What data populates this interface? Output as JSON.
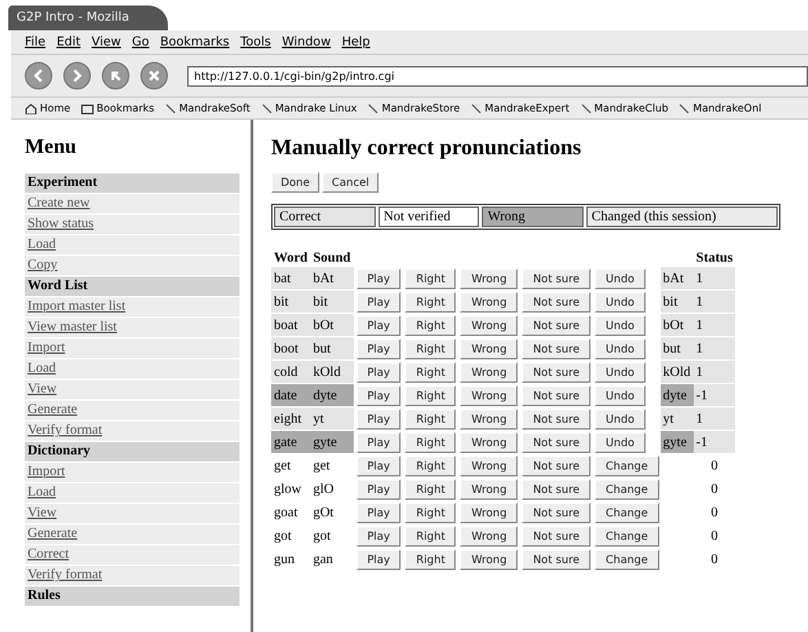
{
  "window": {
    "title": "G2P Intro - Mozilla"
  },
  "menubar": [
    "File",
    "Edit",
    "View",
    "Go",
    "Bookmarks",
    "Tools",
    "Window",
    "Help"
  ],
  "address": "http://127.0.0.1/cgi-bin/g2p/intro.cgi",
  "bookmarks": [
    {
      "label": "Home",
      "kind": "home"
    },
    {
      "label": "Bookmarks",
      "kind": "folder"
    },
    {
      "label": "MandrakeSoft",
      "kind": "link"
    },
    {
      "label": "Mandrake Linux",
      "kind": "link"
    },
    {
      "label": "MandrakeStore",
      "kind": "link"
    },
    {
      "label": "MandrakeExpert",
      "kind": "link"
    },
    {
      "label": "MandrakeClub",
      "kind": "link"
    },
    {
      "label": "MandrakeOnl",
      "kind": "link"
    }
  ],
  "sidebar": {
    "title": "Menu",
    "items": [
      {
        "label": "Experiment",
        "kind": "header"
      },
      {
        "label": "Create new",
        "kind": "link"
      },
      {
        "label": "Show status",
        "kind": "link"
      },
      {
        "label": "Load",
        "kind": "link"
      },
      {
        "label": "Copy",
        "kind": "link"
      },
      {
        "label": "Word List",
        "kind": "header"
      },
      {
        "label": "Import master list",
        "kind": "link"
      },
      {
        "label": "View master list",
        "kind": "link"
      },
      {
        "label": "Import",
        "kind": "link"
      },
      {
        "label": "Load",
        "kind": "link"
      },
      {
        "label": "View",
        "kind": "link"
      },
      {
        "label": "Generate",
        "kind": "link"
      },
      {
        "label": "Verify format",
        "kind": "link"
      },
      {
        "label": "Dictionary",
        "kind": "header"
      },
      {
        "label": "Import",
        "kind": "link"
      },
      {
        "label": "Load",
        "kind": "link"
      },
      {
        "label": "View",
        "kind": "link"
      },
      {
        "label": "Generate",
        "kind": "link"
      },
      {
        "label": "Correct",
        "kind": "link"
      },
      {
        "label": "Verify format",
        "kind": "link"
      },
      {
        "label": "Rules",
        "kind": "header"
      }
    ]
  },
  "main": {
    "title": "Manually correct pronunciations",
    "actions": [
      "Done",
      "Cancel"
    ],
    "legend": [
      {
        "label": "Correct",
        "kind": "correct"
      },
      {
        "label": "Not verified",
        "kind": "unverified"
      },
      {
        "label": "Wrong",
        "kind": "wrong"
      },
      {
        "label": "Changed (this session)",
        "kind": "changed"
      }
    ],
    "columns": {
      "word": "Word",
      "sound": "Sound",
      "status": "Status"
    },
    "rows": [
      {
        "word": "bat",
        "sound": "bAt",
        "kind": "correct",
        "buttons": [
          "Play",
          "Right",
          "Wrong",
          "Not sure",
          "Undo"
        ],
        "pron": "bAt",
        "status": "1"
      },
      {
        "word": "bit",
        "sound": "bit",
        "kind": "correct",
        "buttons": [
          "Play",
          "Right",
          "Wrong",
          "Not sure",
          "Undo"
        ],
        "pron": "bit",
        "status": "1"
      },
      {
        "word": "boat",
        "sound": "bOt",
        "kind": "correct",
        "buttons": [
          "Play",
          "Right",
          "Wrong",
          "Not sure",
          "Undo"
        ],
        "pron": "bOt",
        "status": "1"
      },
      {
        "word": "boot",
        "sound": "but",
        "kind": "correct",
        "buttons": [
          "Play",
          "Right",
          "Wrong",
          "Not sure",
          "Undo"
        ],
        "pron": "but",
        "status": "1"
      },
      {
        "word": "cold",
        "sound": "kOld",
        "kind": "correct",
        "buttons": [
          "Play",
          "Right",
          "Wrong",
          "Not sure",
          "Undo"
        ],
        "pron": "kOld",
        "status": "1"
      },
      {
        "word": "date",
        "sound": "dyte",
        "kind": "wrong",
        "buttons": [
          "Play",
          "Right",
          "Wrong",
          "Not sure",
          "Undo"
        ],
        "pron": "dyte",
        "status": "-1"
      },
      {
        "word": "eight",
        "sound": "yt",
        "kind": "correct",
        "buttons": [
          "Play",
          "Right",
          "Wrong",
          "Not sure",
          "Undo"
        ],
        "pron": "yt",
        "status": "1"
      },
      {
        "word": "gate",
        "sound": "gyte",
        "kind": "wrong",
        "buttons": [
          "Play",
          "Right",
          "Wrong",
          "Not sure",
          "Undo"
        ],
        "pron": "gyte",
        "status": "-1"
      },
      {
        "word": "get",
        "sound": "get",
        "kind": "unverified",
        "buttons": [
          "Play",
          "Right",
          "Wrong",
          "Not sure",
          "Change"
        ],
        "status": "0"
      },
      {
        "word": "glow",
        "sound": "glO",
        "kind": "unverified",
        "buttons": [
          "Play",
          "Right",
          "Wrong",
          "Not sure",
          "Change"
        ],
        "status": "0"
      },
      {
        "word": "goat",
        "sound": "gOt",
        "kind": "unverified",
        "buttons": [
          "Play",
          "Right",
          "Wrong",
          "Not sure",
          "Change"
        ],
        "status": "0"
      },
      {
        "word": "got",
        "sound": "got",
        "kind": "unverified",
        "buttons": [
          "Play",
          "Right",
          "Wrong",
          "Not sure",
          "Change"
        ],
        "status": "0"
      },
      {
        "word": "gun",
        "sound": "gan",
        "kind": "unverified",
        "buttons": [
          "Play",
          "Right",
          "Wrong",
          "Not sure",
          "Change"
        ],
        "status": "0"
      }
    ]
  }
}
